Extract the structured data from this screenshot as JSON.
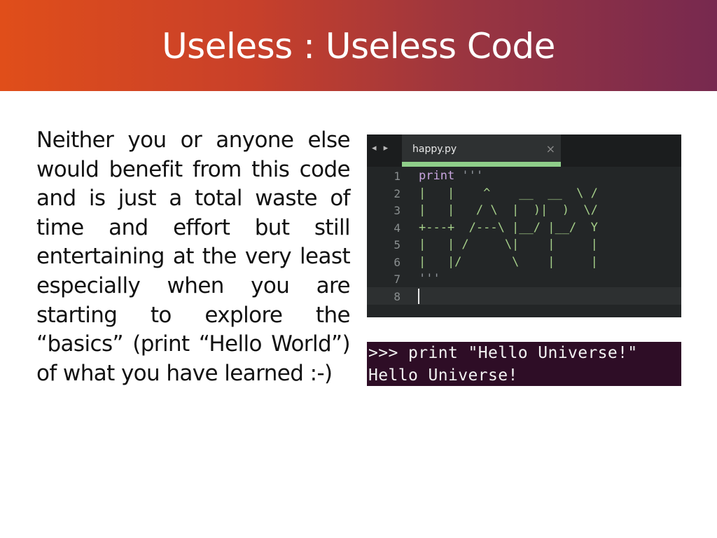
{
  "slide": {
    "title": "Useless : Useless Code",
    "body": "Neither you or anyone else would benefit from this code and is just a total waste of time and effort but still entertaining at the very least especially when you are starting to explore the “basics” (print “Hello World”) of what you have learned :-)"
  },
  "editor": {
    "nav_arrows": "◂ ▸",
    "tab_title": "happy.py",
    "tab_close": "×",
    "line_numbers": [
      "1",
      "2",
      "3",
      "4",
      "5",
      "6",
      "7",
      "8"
    ],
    "code": {
      "keyword": "print",
      "open_quote": " '''",
      "lines": [
        "|   |    ^    __  __  \\ /",
        "|   |   / \\  |  )|  )  \\/",
        "+---+  /---\\ |__/ |__/  Y",
        "|   | /     \\|    |     |",
        "|   |/       \\    |     |"
      ],
      "close_quote": "'''"
    }
  },
  "terminal": {
    "command": ">>> print \"Hello Universe!\"",
    "output": "Hello Universe!"
  },
  "colors": {
    "title_gradient_start": "#e04e1a",
    "title_gradient_end": "#77294f",
    "editor_bg": "#232627",
    "tab_accent": "#8fce8a",
    "terminal_bg": "#2e0d26"
  }
}
